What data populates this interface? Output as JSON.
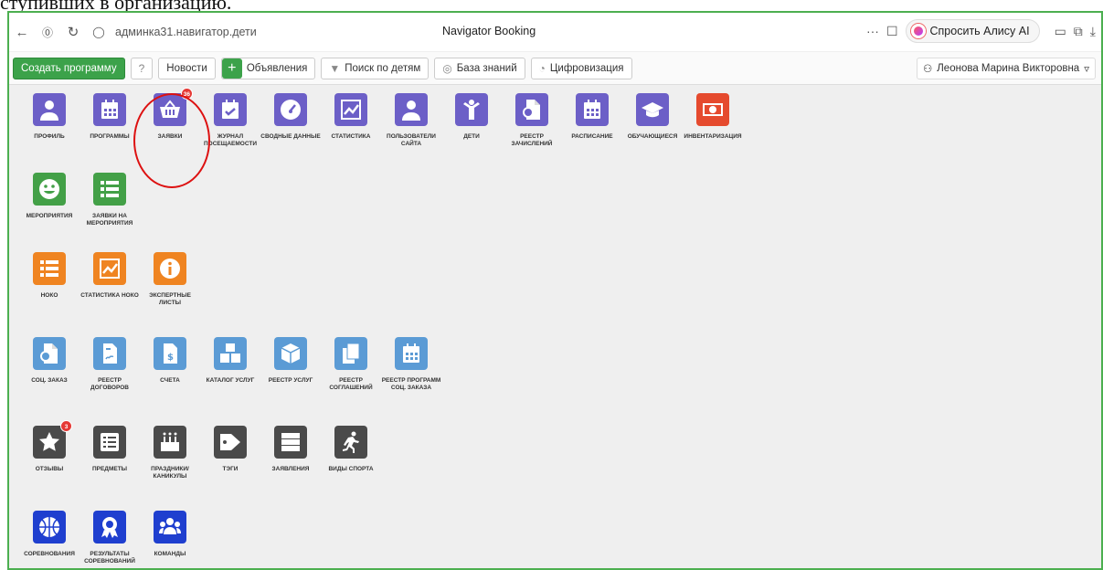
{
  "doc_text": "ступивших в организацию.",
  "browser": {
    "url": "админка31.навигатор.дети",
    "tab_title": "Navigator Booking",
    "alice_label": "Спросить Алису AI"
  },
  "toolbar": {
    "create_program": "Создать программу",
    "news": "Новости",
    "announcements": "Объявления",
    "child_search": "Поиск по детям",
    "knowledge_base": "База знаний",
    "digitalization": "Цифровизация",
    "user_name": "Леонова Марина Викторовна"
  },
  "tiles": [
    {
      "label": "Профиль",
      "color": "#6c5fc7",
      "icon": "user-icon"
    },
    {
      "label": "Программы",
      "color": "#6c5fc7",
      "icon": "calendar-icon"
    },
    {
      "label": "Заявки",
      "color": "#6c5fc7",
      "icon": "basket-icon",
      "badge": "36"
    },
    {
      "label": "Журнал посещаемости",
      "color": "#6c5fc7",
      "icon": "calendar-check-icon"
    },
    {
      "label": "Сводные данные",
      "color": "#6c5fc7",
      "icon": "gauge-icon"
    },
    {
      "label": "Статистика",
      "color": "#6c5fc7",
      "icon": "chart-icon"
    },
    {
      "label": "Пользователи сайта",
      "color": "#6c5fc7",
      "icon": "user-icon"
    },
    {
      "label": "Дети",
      "color": "#6c5fc7",
      "icon": "child-icon"
    },
    {
      "label": "Реестр зачислений",
      "color": "#6c5fc7",
      "icon": "file-certificate-icon"
    },
    {
      "label": "Расписание",
      "color": "#6c5fc7",
      "icon": "calendar-icon"
    },
    {
      "label": "Обучающиеся",
      "color": "#6c5fc7",
      "icon": "graduation-cap-icon"
    },
    {
      "label": "Инвентаризация",
      "color": "#e54a2e",
      "icon": "money-icon"
    },
    {
      "label": "Мероприятия",
      "color": "#43a047",
      "icon": "smile-icon"
    },
    {
      "label": "Заявки на мероприятия",
      "color": "#43a047",
      "icon": "list-icon"
    },
    {
      "label": "НОКО",
      "color": "#ef8421",
      "icon": "list-icon"
    },
    {
      "label": "Статистика НОКО",
      "color": "#ef8421",
      "icon": "chart-icon"
    },
    {
      "label": "Экспертные листы",
      "color": "#ef8421",
      "icon": "info-icon"
    },
    {
      "label": "Соц. заказ",
      "color": "#5b9bd5",
      "icon": "file-certificate-icon"
    },
    {
      "label": "Реестр договоров",
      "color": "#5b9bd5",
      "icon": "file-signature-icon"
    },
    {
      "label": "Счета",
      "color": "#5b9bd5",
      "icon": "invoice-icon"
    },
    {
      "label": "Каталог услуг",
      "color": "#5b9bd5",
      "icon": "boxes-icon"
    },
    {
      "label": "Реестр услуг",
      "color": "#5b9bd5",
      "icon": "box-icon"
    },
    {
      "label": "Реестр соглашений",
      "color": "#5b9bd5",
      "icon": "copy-icon"
    },
    {
      "label": "Реестр программ соц. заказа",
      "color": "#5b9bd5",
      "icon": "calendar-icon"
    },
    {
      "label": "Отзывы",
      "color": "#4a4a4a",
      "icon": "star-icon",
      "badge": "3"
    },
    {
      "label": "Предметы",
      "color": "#4a4a4a",
      "icon": "list-alt-icon"
    },
    {
      "label": "Праздники/ каникулы",
      "color": "#4a4a4a",
      "icon": "cake-icon"
    },
    {
      "label": "Тэги",
      "color": "#4a4a4a",
      "icon": "tag-icon"
    },
    {
      "label": "Заявления",
      "color": "#4a4a4a",
      "icon": "server-icon"
    },
    {
      "label": "Виды спорта",
      "color": "#4a4a4a",
      "icon": "runner-icon"
    },
    {
      "label": "Соревнования",
      "color": "#1f3fcf",
      "icon": "basketball-icon"
    },
    {
      "label": "Результаты соревнований",
      "color": "#1f3fcf",
      "icon": "award-icon"
    },
    {
      "label": "Команды",
      "color": "#1f3fcf",
      "icon": "users-icon"
    }
  ]
}
